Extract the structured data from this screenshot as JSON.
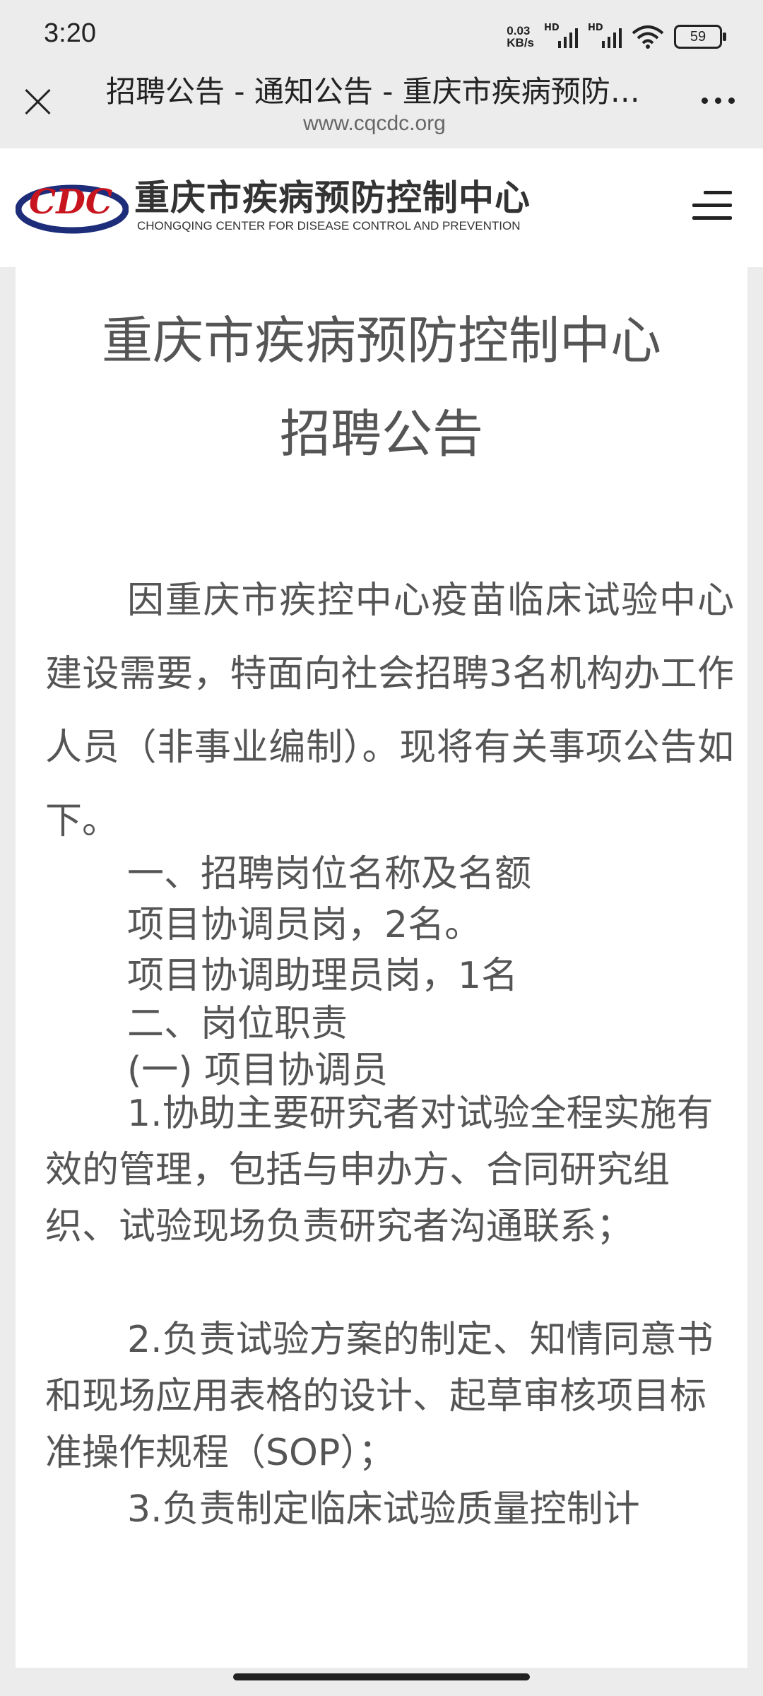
{
  "status_bar": {
    "time": "3:20",
    "net_speed_value": "0.03",
    "net_speed_unit": "KB/s",
    "signal1_label": "HD",
    "signal2_label": "HD",
    "battery": "59"
  },
  "browser": {
    "title": "招聘公告 - 通知公告 - 重庆市疾病预防控制中心",
    "url": "www.cqcdc.org"
  },
  "site": {
    "name_cn": "重庆市疾病预防控制中心",
    "name_en": "CHONGQING CENTER FOR DISEASE CONTROL AND PREVENTION",
    "logo_text": "CDC"
  },
  "article": {
    "title_line1": "重庆市疾病预防控制中心",
    "title_line2": "招聘公告",
    "intro": "因重庆市疾控中心疫苗临床试验中心建设需要，特面向社会招聘3名机构办工作人员（非事业编制）。现将有关事项公告如下。",
    "section1_heading": "一、招聘岗位名称及名额",
    "position1": "项目协调员岗，2名。",
    "position2": "项目协调助理员岗，1名",
    "section2_heading": "二、岗位职责",
    "subsection1_heading": "(一) 项目协调员",
    "duty1": "1.协助主要研究者对试验全程实施有效的管理，包括与申办方、合同研究组织、试验现场负责研究者沟通联系；",
    "duty2": "2.负责试验方案的制定、知情同意书和现场应用表格的设计、起草审核项目标准操作规程（SOP）；",
    "duty3": "3.负责制定临床试验质量控制计"
  }
}
